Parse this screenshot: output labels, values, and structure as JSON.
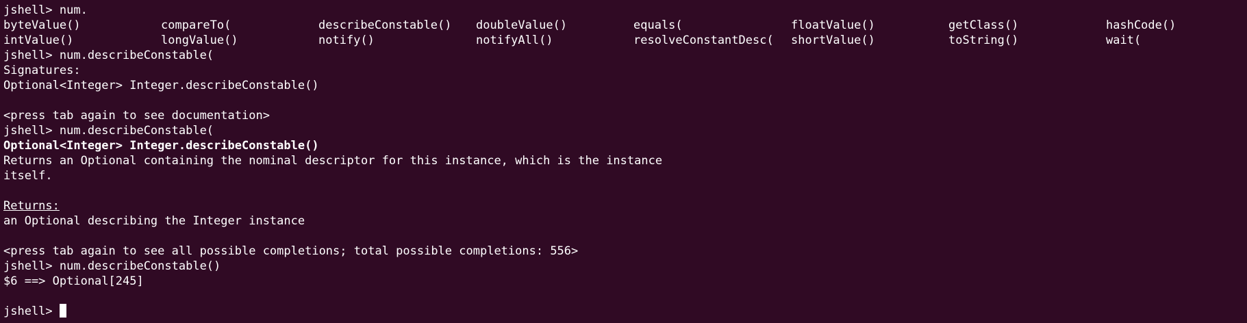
{
  "terminal": {
    "background": "#300a24",
    "foreground": "#ffffff",
    "partial_top_line": "jshell> num.",
    "prompt1": "jshell> num.",
    "completions_row1": [
      "byteValue()",
      "compareTo(",
      "describeConstable()",
      "doubleValue()",
      "equals(",
      "floatValue()",
      "getClass()",
      "hashCode()"
    ],
    "completions_row2": [
      "intValue()",
      "longValue()",
      "notify()",
      "notifyAll()",
      "resolveConstantDesc(",
      "shortValue()",
      "toString()",
      "wait("
    ],
    "prompt2": "jshell> num.describeConstable(",
    "signatures_label": "Signatures:",
    "signature": "Optional<Integer> Integer.describeConstable()",
    "press_tab_doc": "<press tab again to see documentation>",
    "prompt3": "jshell> num.describeConstable(",
    "doc_signature": "Optional<Integer> Integer.describeConstable()",
    "doc_text_line1": "Returns an Optional containing the nominal descriptor for this instance, which is the instance",
    "doc_text_line2": "itself.",
    "returns_label": "Returns:",
    "returns_text": "an Optional describing the Integer instance",
    "press_tab_completions": "<press tab again to see all possible completions; total possible completions: 556>",
    "prompt4": "jshell> num.describeConstable()",
    "result": "$6 ==> Optional[245]",
    "final_prompt": "jshell> "
  }
}
